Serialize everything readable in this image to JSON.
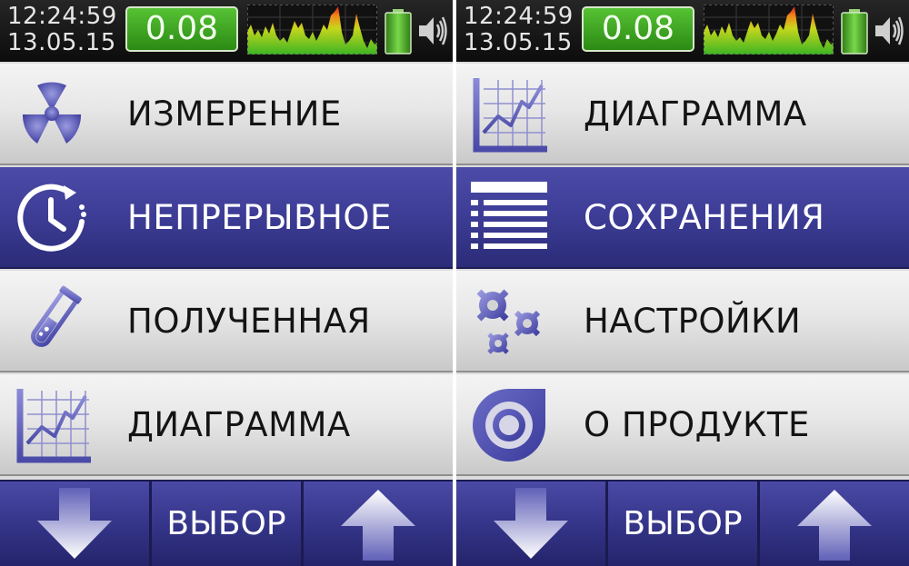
{
  "panels": [
    {
      "status": {
        "time": "12:24:59",
        "date": "13.05.15",
        "dose_rate": "0.08",
        "graph_icon": "radiation-history-graph-icon",
        "battery_icon": "battery-icon",
        "sound_icon": "speaker-icon"
      },
      "menu": [
        {
          "label": "ИЗМЕРЕНИЕ",
          "icon": "radiation-icon",
          "selected": false
        },
        {
          "label": "НЕПРЕРЫВНОЕ",
          "icon": "timer-icon",
          "selected": true
        },
        {
          "label": "ПОЛУЧЕННАЯ",
          "icon": "test-tube-icon",
          "selected": false
        },
        {
          "label": "ДИАГРАММА",
          "icon": "chart-icon",
          "selected": false
        }
      ],
      "buttons": {
        "down_icon": "arrow-down-icon",
        "select_label": "ВЫБОР",
        "up_icon": "arrow-up-icon"
      }
    },
    {
      "status": {
        "time": "12:24:59",
        "date": "13.05.15",
        "dose_rate": "0.08",
        "graph_icon": "radiation-history-graph-icon",
        "battery_icon": "battery-icon",
        "sound_icon": "speaker-icon"
      },
      "menu": [
        {
          "label": "ДИАГРАММА",
          "icon": "chart-icon",
          "selected": false
        },
        {
          "label": "СОХРАНЕНИЯ",
          "icon": "list-icon",
          "selected": true
        },
        {
          "label": "НАСТРОЙКИ",
          "icon": "gears-icon",
          "selected": false
        },
        {
          "label": "О ПРОДУКТЕ",
          "icon": "product-logo-icon",
          "selected": false
        }
      ],
      "buttons": {
        "down_icon": "arrow-down-icon",
        "select_label": "ВЫБОР",
        "up_icon": "arrow-up-icon"
      }
    }
  ],
  "colors": {
    "accent": "#3e3e98",
    "dose_green": "#3aa620",
    "icon_blue": "#5656b8"
  }
}
